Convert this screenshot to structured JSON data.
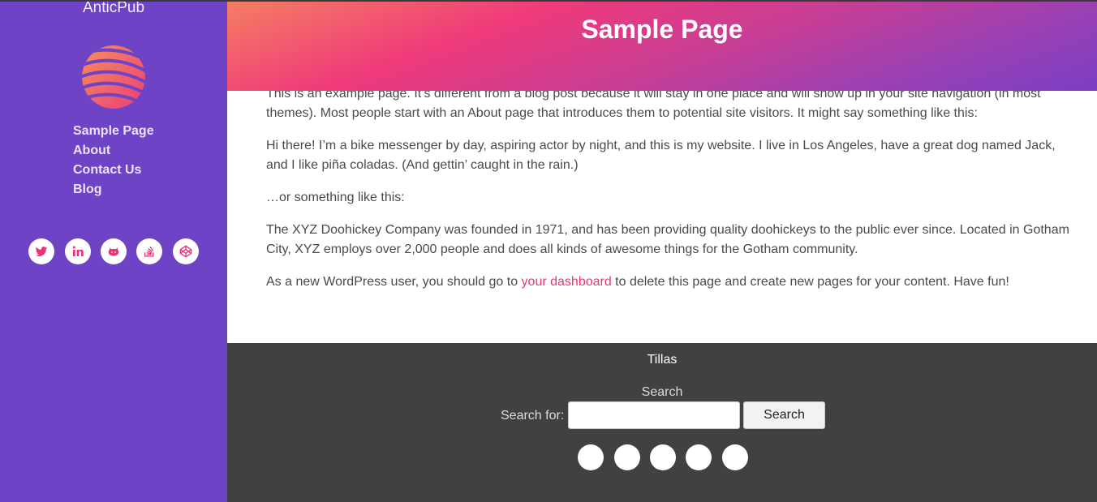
{
  "site": {
    "title": "AnticPub"
  },
  "sidebar": {
    "nav": [
      {
        "label": "Sample Page"
      },
      {
        "label": "About"
      },
      {
        "label": "Contact Us"
      },
      {
        "label": "Blog"
      }
    ],
    "social_icons": [
      "twitter-icon",
      "linkedin-icon",
      "github-icon",
      "stackoverflow-icon",
      "codepen-icon"
    ]
  },
  "colors": {
    "sidebar_bg": "#6f43c5",
    "accent": "#e8357a",
    "footer_bg": "#414141"
  },
  "header": {
    "title": "Sample Page"
  },
  "content": {
    "p1": "This is an example page. It’s different from a blog post because it will stay in one place and will show up in your site navigation (in most themes). Most people start with an About page that introduces them to potential site visitors. It might say something like this:",
    "p2": "Hi there! I’m a bike messenger by day, aspiring actor by night, and this is my website. I live in Los Angeles, have a great dog named Jack, and I like piña coladas. (And gettin’ caught in the rain.)",
    "p3": "…or something like this:",
    "p4": "The XYZ Doohickey Company was founded in 1971, and has been providing quality doohickeys to the public ever since. Located in Gotham City, XYZ employs over 2,000 people and does all kinds of awesome things for the Gotham community.",
    "p5_before": "As a new WordPress user, you should go to ",
    "p5_link": "your dashboard",
    "p5_after": " to delete this page and create new pages for your content. Have fun!"
  },
  "footer": {
    "title": "Tillas",
    "search_heading": "Search",
    "search_label": "Search for:",
    "search_value": "",
    "search_button": "Search"
  }
}
